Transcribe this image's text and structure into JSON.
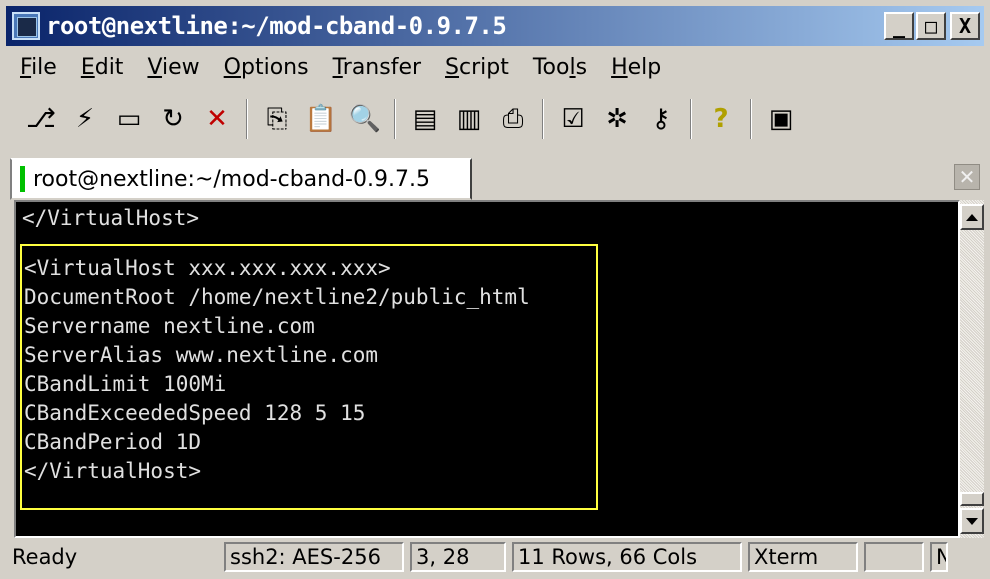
{
  "window": {
    "title": "root@nextline:~/mod-cband-0.9.7.5",
    "controls": {
      "minimize": "_",
      "maximize": "□",
      "close": "X"
    }
  },
  "menu": [
    {
      "label": "File",
      "key": "F",
      "rest": "ile"
    },
    {
      "label": "Edit",
      "key": "E",
      "rest": "dit"
    },
    {
      "label": "View",
      "key": "V",
      "rest": "iew"
    },
    {
      "label": "Options",
      "key": "O",
      "rest": "ptions"
    },
    {
      "label": "Transfer",
      "key": "T",
      "rest": "ransfer"
    },
    {
      "label": "Script",
      "key": "S",
      "rest": "cript"
    },
    {
      "label": "Tools",
      "pre": "Too",
      "key": "l",
      "rest": "s"
    },
    {
      "label": "Help",
      "key": "H",
      "rest": "elp"
    }
  ],
  "toolbar": {
    "icons": [
      "connect-icon",
      "quick-connect-icon",
      "connect-tab-icon",
      "reconnect-icon",
      "disconnect-icon",
      "copy-icon",
      "paste-icon",
      "find-icon",
      "print-setup-icon",
      "print-selection-icon",
      "print-icon",
      "session-options-icon",
      "global-options-icon",
      "keymap-icon",
      "help-icon",
      "sftp-icon"
    ]
  },
  "tab": {
    "label": "root@nextline:~/mod-cband-0.9.7.5",
    "indicator_color": "#00c000"
  },
  "terminal": {
    "pre_line": "</VirtualHost>",
    "block_lines": [
      "<VirtualHost xxx.xxx.xxx.xxx>",
      "DocumentRoot /home/nextline2/public_html",
      "Servername nextline.com",
      "ServerAlias www.nextline.com",
      "CBandLimit 100Mi",
      "CBandExceededSpeed 128 5 15",
      "CBandPeriod 1D",
      "</VirtualHost>"
    ],
    "highlight_color": "#ffff40"
  },
  "status": {
    "ready": "Ready",
    "cipher": "ssh2: AES-256",
    "cursor": "3,  28",
    "size": "11 Rows,  66 Cols",
    "term_type": "Xterm",
    "extra1": "",
    "extra2": "N"
  }
}
